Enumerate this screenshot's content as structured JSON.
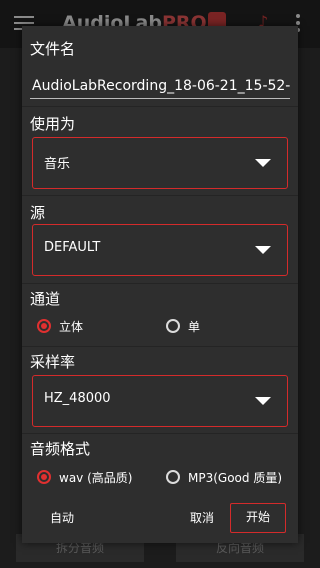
{
  "background": {
    "app_title": "AudioLab",
    "app_title_suffix": "PRO",
    "bottom_buttons": [
      "拆分音频",
      "反向音频"
    ]
  },
  "dialog": {
    "filename": {
      "label": "文件名",
      "value": "AudioLabRecording_18-06-21_15-52-"
    },
    "use_as": {
      "label": "使用为",
      "selected": "音乐"
    },
    "source": {
      "label": "源",
      "selected": "DEFAULT"
    },
    "channel": {
      "label": "通道",
      "options": [
        {
          "label": "立体",
          "checked": true
        },
        {
          "label": "单",
          "checked": false
        }
      ]
    },
    "sample_rate": {
      "label": "采样率",
      "selected": "HZ_48000"
    },
    "audio_format": {
      "label": "音频格式",
      "options": [
        {
          "label": "wav (高品质)",
          "checked": true
        },
        {
          "label": "MP3(Good 质量)",
          "checked": false
        }
      ]
    },
    "buttons": {
      "auto": "自动",
      "cancel": "取消",
      "start": "开始"
    }
  },
  "colors": {
    "accent": "#d42b2b",
    "dialog_bg": "#2e2e2e",
    "backdrop": "#1c1c1c"
  }
}
